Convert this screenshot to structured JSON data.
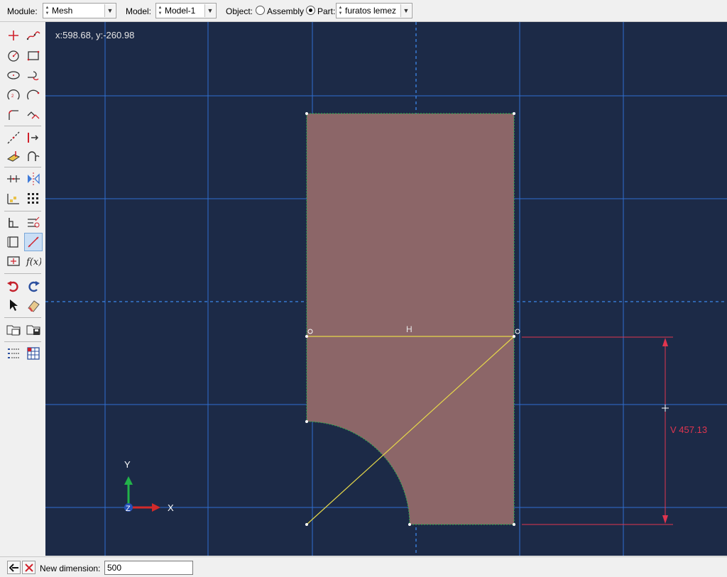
{
  "context_bar": {
    "module_label": "Module:",
    "module_value": "Mesh",
    "model_label": "Model:",
    "model_value": "Model-1",
    "object_label": "Object:",
    "assembly_label": "Assembly",
    "part_label": "Part:",
    "part_value": "furatos lemez",
    "selected_object": "Part"
  },
  "viewport": {
    "cursor_coords": "x:598.68, y:-260.98",
    "horizontal_constraint_label": "H",
    "dimension_label": "V 457.13",
    "triad": {
      "y": "Y",
      "z": "Z",
      "x": "X"
    },
    "colors": {
      "background": "#1c2a47",
      "grid": "#2f6fd0",
      "part_fill": "#8c6668",
      "construction": "#e6d84a",
      "dimension": "#e0354f"
    }
  },
  "prompt": {
    "label": "New dimension:",
    "value": "500"
  },
  "toolbox": {
    "icons": [
      "point-icon",
      "spline-icon",
      "circle-icon",
      "rectangle-icon",
      "ellipse-icon",
      "fillet-arc-icon",
      "arc-3point-icon",
      "arc-tangent-icon",
      "fillet-icon",
      "offset-icon",
      "construction-line-icon",
      "split-icon",
      "project-edges-icon",
      "arc-tangent-icon",
      "horizontal-constraint-icon",
      "mirror-icon",
      "linear-pattern-icon",
      "radial-pattern-icon",
      "dimension-icon",
      "edit-dimension-icon",
      "add-dimension-icon",
      "parameter-icon",
      "undo-icon",
      "redo-icon",
      "select-icon",
      "erase-icon",
      "sketch-save-icon",
      "sketch-load-icon",
      "options-list-icon",
      "grid-icon"
    ]
  }
}
